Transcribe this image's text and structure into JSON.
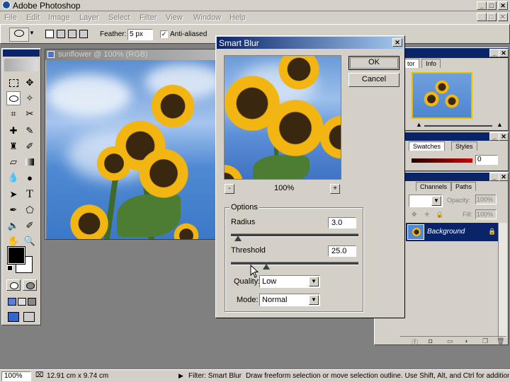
{
  "app": {
    "title": "Adobe Photoshop",
    "icon": "photoshop-app-icon"
  },
  "window_controls": {
    "minimize": "_",
    "restore": "□",
    "close": "✕"
  },
  "menu": [
    "File",
    "Edit",
    "Image",
    "Layer",
    "Select",
    "Filter",
    "View",
    "Window",
    "Help"
  ],
  "options_bar": {
    "feather_label": "Feather:",
    "feather_value": "5 px",
    "antialiased_label": "Anti-aliased",
    "antialiased_checked": true
  },
  "document": {
    "title": "sunflower @ 100% (RGB)"
  },
  "dialog": {
    "title": "Smart Blur",
    "ok_label": "OK",
    "cancel_label": "Cancel",
    "zoom_out": "-",
    "zoom_in": "+",
    "zoom_level": "100%",
    "options_group": "Options",
    "radius_label": "Radius",
    "radius_value": "3.0",
    "radius_slider_level": 0.03,
    "threshold_label": "Threshold",
    "threshold_value": "25.0",
    "threshold_slider_level": 0.25,
    "quality_label": "Quality:",
    "quality_value": "Low",
    "mode_label": "Mode:",
    "mode_value": "Normal"
  },
  "navigator_panel": {
    "tabs": [
      "tor",
      "Info"
    ]
  },
  "swatches_panel": {
    "tabs": [
      "Swatches",
      "Styles"
    ],
    "field_value": "0"
  },
  "layers_panel": {
    "tabs": [
      "Channels",
      "Paths"
    ],
    "opacity_label": "Opacity:",
    "opacity_value": "100%",
    "fill_label": "Fill:",
    "fill_value": "100%",
    "layer_name": "Background"
  },
  "status_bar": {
    "zoom": "100%",
    "doc_size": "12.91 cm x 9.74 cm",
    "filter_text": "Filter: Smart Blur",
    "hint": "Draw freeform selection or move selection outline.  Use Shift, Alt, and Ctrl for additional optic"
  },
  "colors": {
    "title_active": "#0a246a",
    "title_gradient_end": "#a6caf0",
    "chrome": "#d4d0c8",
    "workspace": "#808080",
    "layer_selected": "#0a246a"
  }
}
